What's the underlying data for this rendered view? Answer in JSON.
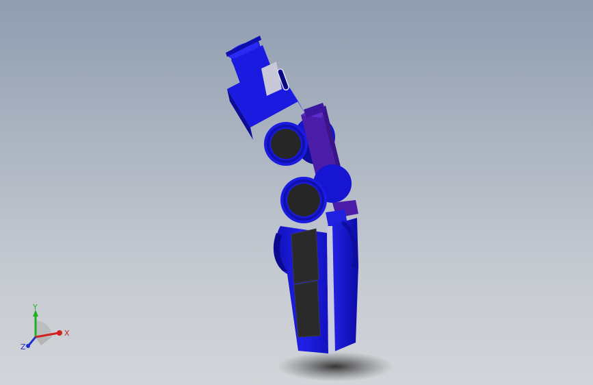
{
  "viewport": {
    "background_top": "#8f9db0",
    "background_bottom": "#d2d5d9"
  },
  "model": {
    "primary_color": "#1a1ae0",
    "dark_color": "#0d0d9a",
    "accent_color": "#4a1ca8",
    "pad_color": "#2a2a2a"
  },
  "triad": {
    "x_label": "X",
    "y_label": "Y",
    "z_label": "Z",
    "x_color": "#d02020",
    "y_color": "#20b020",
    "z_color": "#2030d0"
  }
}
